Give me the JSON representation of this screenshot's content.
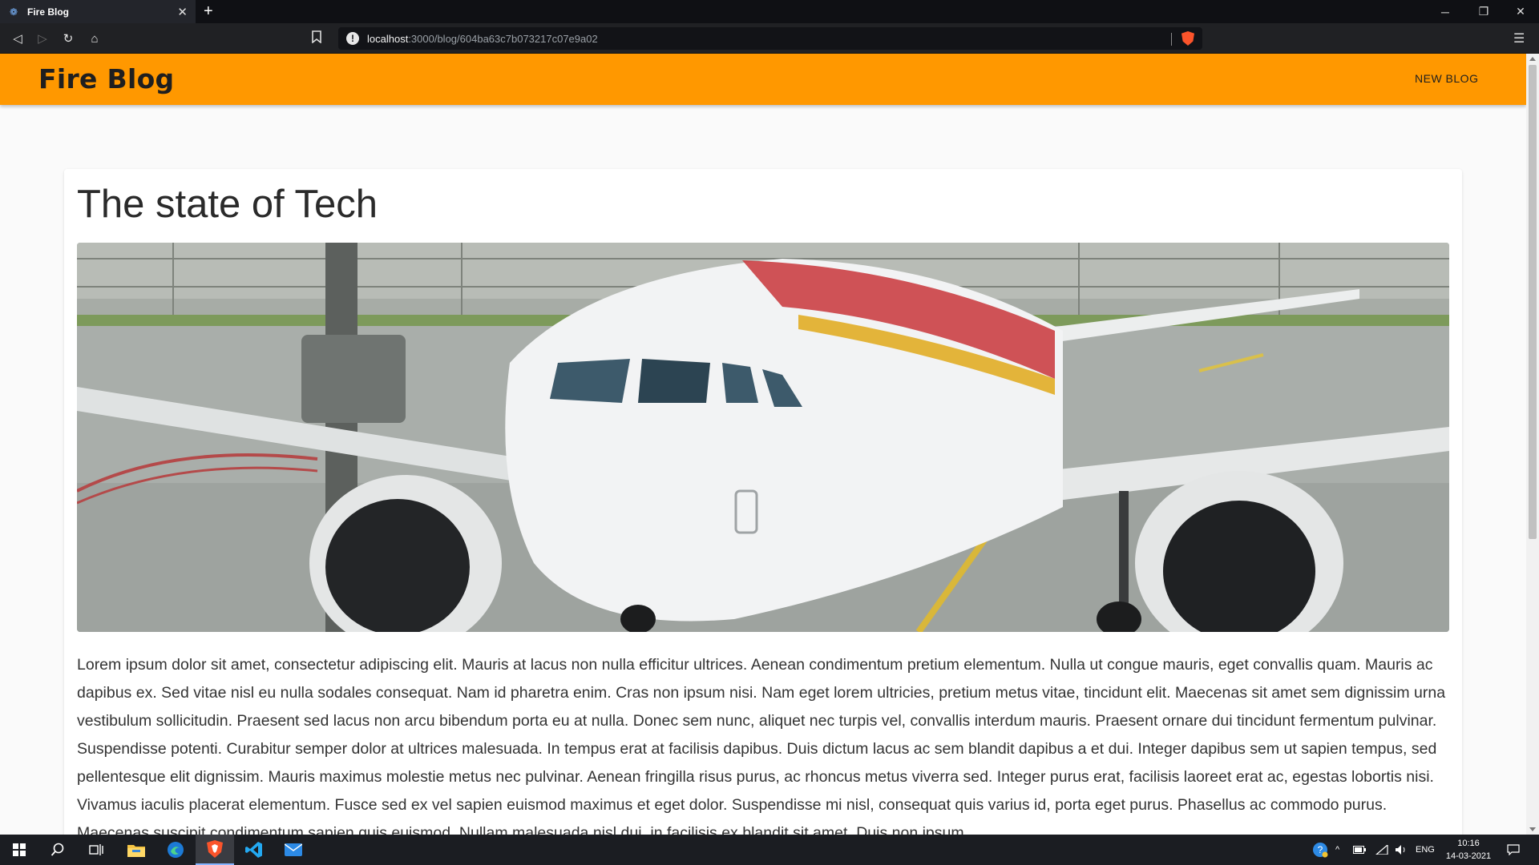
{
  "browser": {
    "tab_title": "Fire Blog",
    "url_host": "localhost",
    "url_path": ":3000/blog/604ba63c7b073217c07e9a02"
  },
  "app": {
    "brand": "Fire Blog",
    "nav_new_blog": "NEW BLOG",
    "accent_color": "#ff9800"
  },
  "post": {
    "title": "The state of Tech",
    "hero_image": "airplane-photo",
    "body": "Lorem ipsum dolor sit amet, consectetur adipiscing elit. Mauris at lacus non nulla efficitur ultrices. Aenean condimentum pretium elementum. Nulla ut congue mauris, eget convallis quam. Mauris ac dapibus ex. Sed vitae nisl eu nulla sodales consequat. Nam id pharetra enim. Cras non ipsum nisi. Nam eget lorem ultricies, pretium metus vitae, tincidunt elit. Maecenas sit amet sem dignissim urna vestibulum sollicitudin. Praesent sed lacus non arcu bibendum porta eu at nulla. Donec sem nunc, aliquet nec turpis vel, convallis interdum mauris. Praesent ornare dui tincidunt fermentum pulvinar. Suspendisse potenti. Curabitur semper dolor at ultrices malesuada. In tempus erat at facilisis dapibus. Duis dictum lacus ac sem blandit dapibus a et dui. Integer dapibus sem ut sapien tempus, sed pellentesque elit dignissim. Mauris maximus molestie metus nec pulvinar. Aenean fringilla risus purus, ac rhoncus metus viverra sed. Integer purus erat, facilisis laoreet erat ac, egestas lobortis nisi. Vivamus iaculis placerat elementum. Fusce sed ex vel sapien euismod maximus et eget dolor. Suspendisse mi nisl, consequat quis varius id, porta eget purus. Phasellus ac commodo purus. Maecenas suscipit condimentum sapien quis euismod. Nullam malesuada nisl dui, in facilisis ex blandit sit amet. Duis non ipsum"
  },
  "taskbar": {
    "language": "ENG",
    "time": "10:16",
    "date": "14-03-2021"
  }
}
